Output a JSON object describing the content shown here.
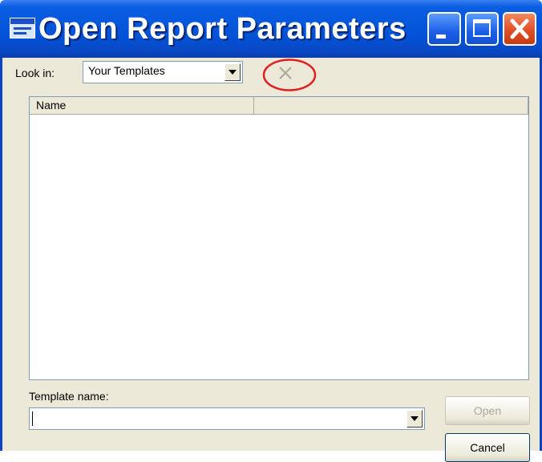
{
  "window": {
    "title": "Open Report Parameters",
    "app_icon": "report-app-icon",
    "controls": {
      "minimize": "minimize-icon",
      "maximize": "maximize-icon",
      "close": "close-icon"
    }
  },
  "lookin": {
    "label": "Look in:",
    "selected": "Your Templates",
    "dropdown_icon": "chevron-down-icon"
  },
  "toolbar": {
    "delete_icon": "delete-icon",
    "delete_enabled": false,
    "highlight_color": "#e02020"
  },
  "file_list": {
    "columns": [
      "Name",
      ""
    ],
    "rows": []
  },
  "template": {
    "label": "Template name:",
    "value": ""
  },
  "buttons": {
    "open_label": "Open",
    "open_enabled": false,
    "cancel_label": "Cancel"
  },
  "colors": {
    "titlebar": "#0556dc",
    "dialog_bg": "#ece9d8",
    "border": "#7f9db9"
  }
}
